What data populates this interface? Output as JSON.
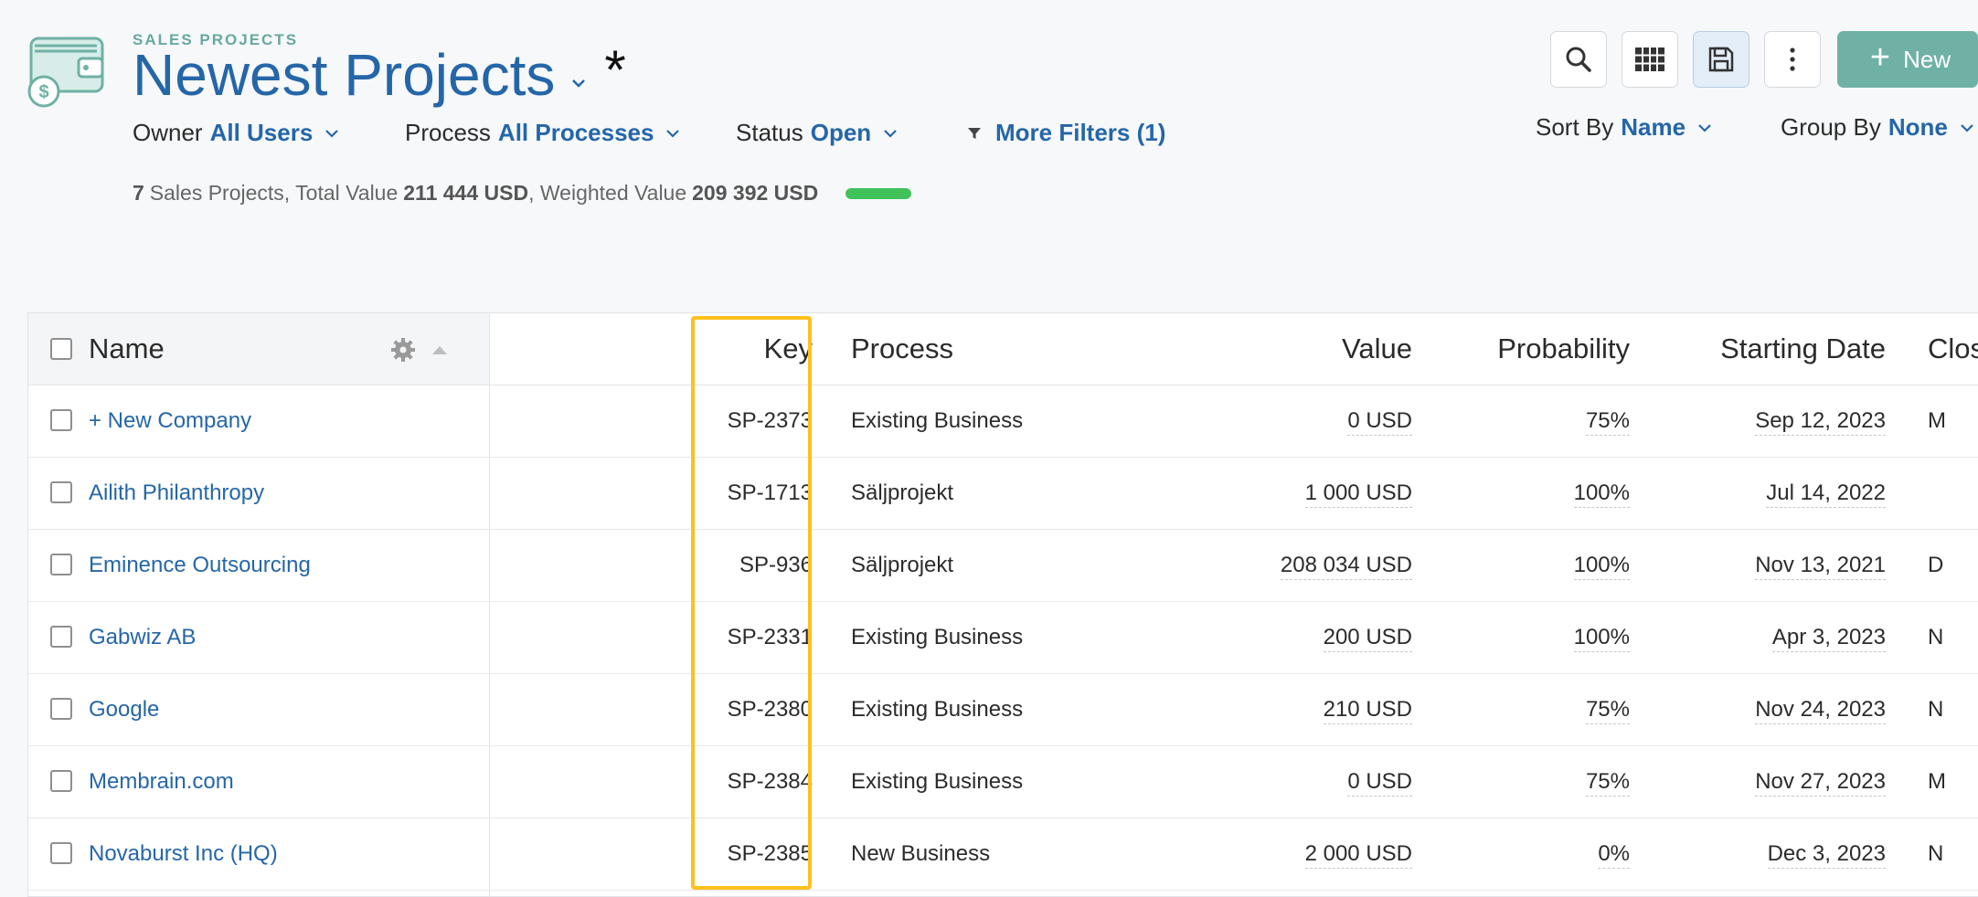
{
  "header": {
    "breadcrumb": "SALES PROJECTS",
    "title": "Newest Projects",
    "unsaved_marker": "*",
    "logo_icon": "wallet-dollar-icon"
  },
  "filters": {
    "owner": {
      "label": "Owner",
      "value": "All Users"
    },
    "process": {
      "label": "Process",
      "value": "All Processes"
    },
    "status": {
      "label": "Status",
      "value": "Open"
    },
    "more": {
      "label": "More Filters (1)",
      "icon": "filter-icon"
    }
  },
  "summary": {
    "count": "7",
    "count_text": "Sales Projects, Total Value",
    "total_value": "211 444 USD",
    "weighted_text": ", Weighted Value",
    "weighted_value": "209 392 USD",
    "progress_fraction": 1.0,
    "progress_color": "#3fc25a"
  },
  "toolbar": {
    "search_icon": "search-icon",
    "columns_icon": "grid-icon",
    "save_icon": "save-icon",
    "more_icon": "more-vertical-icon",
    "new_label": "New"
  },
  "sort": {
    "label": "Sort By",
    "value": "Name"
  },
  "group": {
    "label": "Group By",
    "value": "None"
  },
  "table": {
    "columns": {
      "name": "Name",
      "key": "Key",
      "process": "Process",
      "value": "Value",
      "probability": "Probability",
      "starting_date": "Starting Date",
      "closing": "Clos"
    },
    "rows": [
      {
        "name": "+ New Company",
        "key": "SP-2373",
        "process": "Existing Business",
        "value": "0 USD",
        "probability": "75%",
        "starting_date": "Sep 12, 2023",
        "closing": "M"
      },
      {
        "name": "Ailith Philanthropy",
        "key": "SP-1713",
        "process": "Säljprojekt",
        "value": "1 000 USD",
        "probability": "100%",
        "starting_date": "Jul 14, 2022",
        "closing": ""
      },
      {
        "name": "Eminence Outsourcing",
        "key": "SP-936",
        "process": "Säljprojekt",
        "value": "208 034 USD",
        "probability": "100%",
        "starting_date": "Nov 13, 2021",
        "closing": "D"
      },
      {
        "name": "Gabwiz AB",
        "key": "SP-2331",
        "process": "Existing Business",
        "value": "200 USD",
        "probability": "100%",
        "starting_date": "Apr 3, 2023",
        "closing": "N"
      },
      {
        "name": "Google",
        "key": "SP-2380",
        "process": "Existing Business",
        "value": "210 USD",
        "probability": "75%",
        "starting_date": "Nov 24, 2023",
        "closing": "N"
      },
      {
        "name": "Membrain.com",
        "key": "SP-2384",
        "process": "Existing Business",
        "value": "0 USD",
        "probability": "75%",
        "starting_date": "Nov 27, 2023",
        "closing": "M"
      },
      {
        "name": "Novaburst Inc (HQ)",
        "key": "SP-2385",
        "process": "New Business",
        "value": "2 000 USD",
        "probability": "0%",
        "starting_date": "Dec 3, 2023",
        "closing": "N"
      }
    ]
  },
  "highlight_color": "#ffc01e"
}
